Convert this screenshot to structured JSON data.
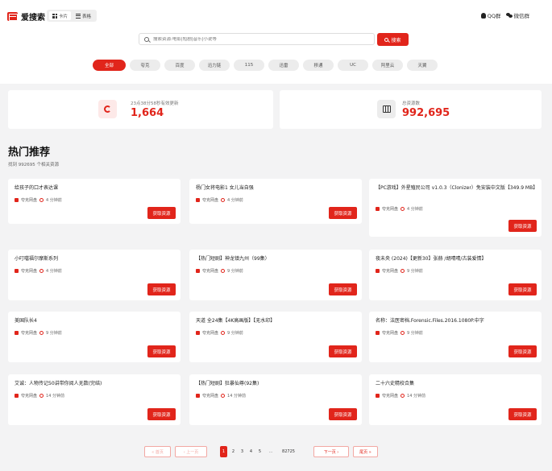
{
  "brand": {
    "title": "爱搜索"
  },
  "view_toggle": [
    {
      "label": "卡片",
      "active": true
    },
    {
      "label": "表格",
      "active": false
    }
  ],
  "top_links": {
    "qq": "QQ群",
    "wechat": "微信群"
  },
  "search": {
    "placeholder": "搜索资源:电影|短剧|音乐|小说等",
    "button": "搜索"
  },
  "filters": [
    "全部",
    "夸克",
    "百度",
    "迅力链",
    "115",
    "迅雷",
    "移通",
    "UC",
    "阿里云",
    "天翼"
  ],
  "stats": {
    "updated_label": "23点38分58秒有效更新",
    "updated_value": "1,664",
    "total_label": "总资源数",
    "total_value": "992,695"
  },
  "section": {
    "title": "热门推荐",
    "subtitle": "找到 992695 个相关资源"
  },
  "card_button": "获取资源",
  "cards": [
    {
      "title": "给孩子的口才表达课",
      "source": "夸克网盘",
      "time": "4 分钟前"
    },
    {
      "title": "杨门女将电影1 女儿当自强",
      "source": "夸克网盘",
      "time": "4 分钟前"
    },
    {
      "title": "【PC游戏】外星殖民公司 v1.0.3（Clonizer）免安装中文版【349.9 MB】",
      "source": "夸克网盘",
      "time": "4 分钟前"
    },
    {
      "title": "小叮噹福尔摩斯系列",
      "source": "夸克网盘",
      "time": "4 分钟前"
    },
    {
      "title": "【热门短剧】神龙镇九州（99集）",
      "source": "夸克网盘",
      "time": "9 分钟前"
    },
    {
      "title": "夜未央 (2024)【更新30】张赫 /胡晴晴/古装爱情】",
      "source": "夸克网盘",
      "time": "9 分钟前"
    },
    {
      "title": "美国队长4",
      "source": "夸克网盘",
      "time": "9 分钟前"
    },
    {
      "title": "天道 全24集【4K高画版】【无水印】",
      "source": "夸克网盘",
      "time": "9 分钟前"
    },
    {
      "title": "名称：法医密档.Forensic.Files.2016.1080P.中字",
      "source": "夸克网盘",
      "time": "9 分钟前"
    },
    {
      "title": "艾诚：人物传记50讲带你阅人无数(完结)",
      "source": "夸克网盘",
      "time": "14 分钟前"
    },
    {
      "title": "【热门短剧】狂暴仙尊(92集)",
      "source": "夸克网盘",
      "time": "14 分钟前"
    },
    {
      "title": "二十六史精校合集",
      "source": "夸克网盘",
      "time": "14 分钟前"
    }
  ],
  "pagination": {
    "first": "« 首页",
    "prev": "‹ 上一页",
    "pages": [
      "1",
      "2",
      "3",
      "4",
      "5"
    ],
    "ellipsis": "...",
    "last_page": "82725",
    "next": "下一页 ›",
    "last": "尾页 »"
  }
}
